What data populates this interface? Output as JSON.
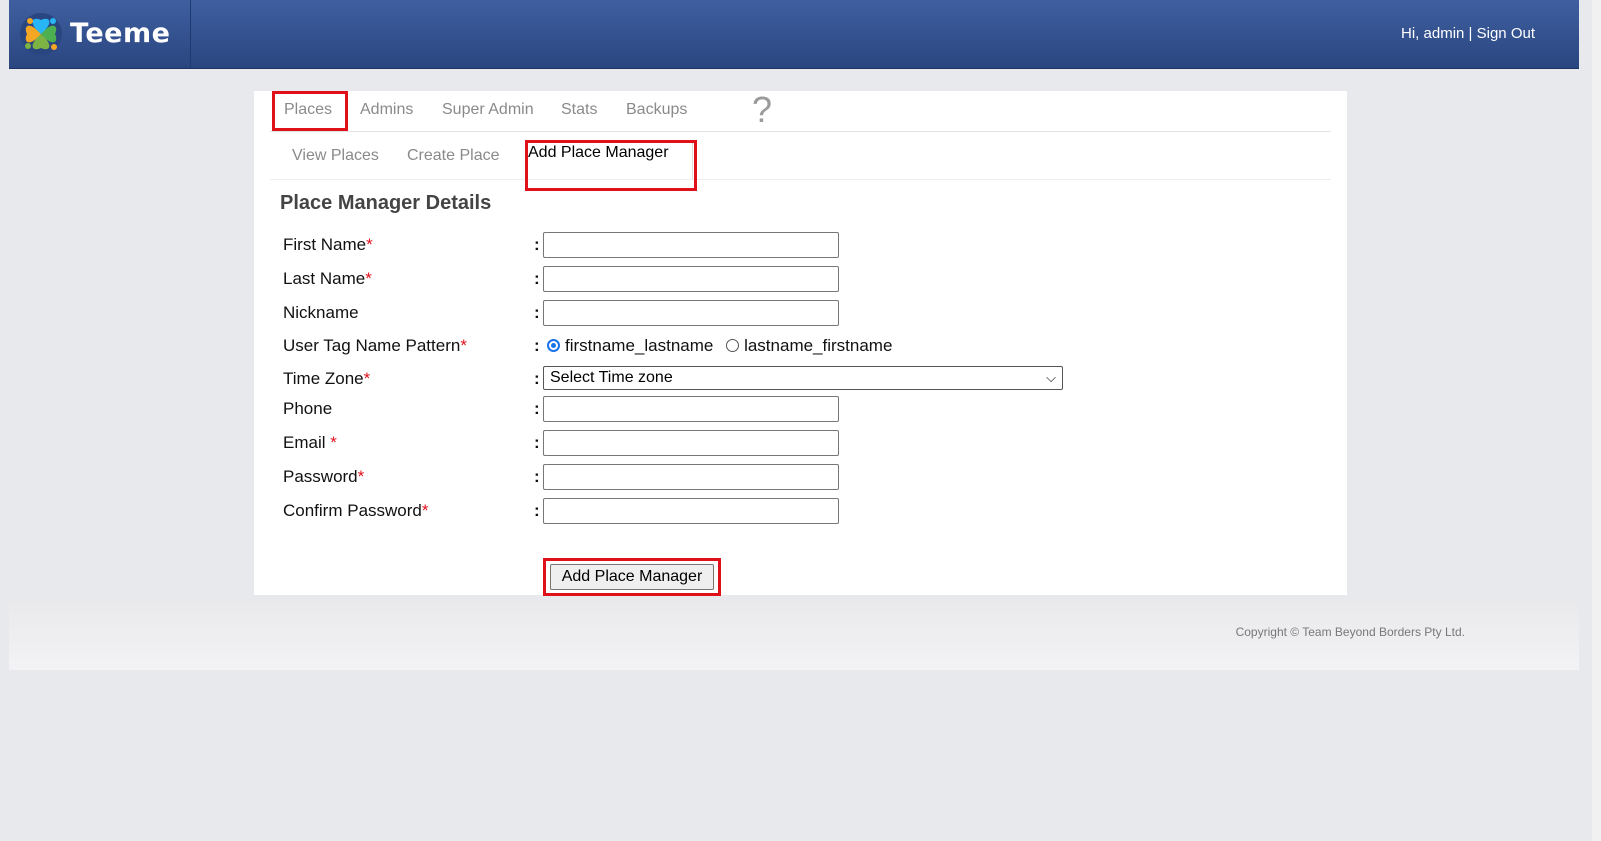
{
  "header": {
    "logo_text": "Teeme",
    "greeting": "Hi, admin",
    "separator": "|",
    "signout_label": "Sign Out"
  },
  "tabs": [
    {
      "label": "Places",
      "active": true
    },
    {
      "label": "Admins"
    },
    {
      "label": "Super Admin"
    },
    {
      "label": "Stats"
    },
    {
      "label": "Backups"
    }
  ],
  "help_label": "?",
  "subtabs": [
    {
      "label": "View Places"
    },
    {
      "label": "Create Place"
    },
    {
      "label": "Add Place Manager",
      "active": true
    }
  ],
  "form": {
    "title": "Place Manager Details",
    "colon": ":",
    "required_marker": "*",
    "fields": [
      {
        "label": "First Name",
        "required": true,
        "type": "text",
        "value": ""
      },
      {
        "label": "Last Name",
        "required": true,
        "type": "text",
        "value": ""
      },
      {
        "label": "Nickname",
        "required": false,
        "type": "text",
        "value": ""
      },
      {
        "label": "User Tag Name Pattern",
        "required": true,
        "type": "radio",
        "options": [
          "firstname_lastname",
          "lastname_firstname"
        ],
        "selected": "firstname_lastname"
      },
      {
        "label": "Time Zone",
        "required": true,
        "type": "select",
        "value": "Select Time zone"
      },
      {
        "label": "Phone",
        "required": false,
        "type": "text",
        "value": ""
      },
      {
        "label": "Email ",
        "required": true,
        "type": "text",
        "value": ""
      },
      {
        "label": "Password",
        "required": true,
        "type": "password",
        "value": ""
      },
      {
        "label": "Confirm Password",
        "required": true,
        "type": "password",
        "value": ""
      }
    ],
    "submit_label": "Add Place Manager"
  },
  "footer": {
    "copyright": "Copyright © Team Beyond Borders Pty Ltd."
  },
  "colors": {
    "header_bg": "#3a5a99",
    "highlight_red": "#e0101b",
    "radio_blue": "#1a73e8"
  }
}
